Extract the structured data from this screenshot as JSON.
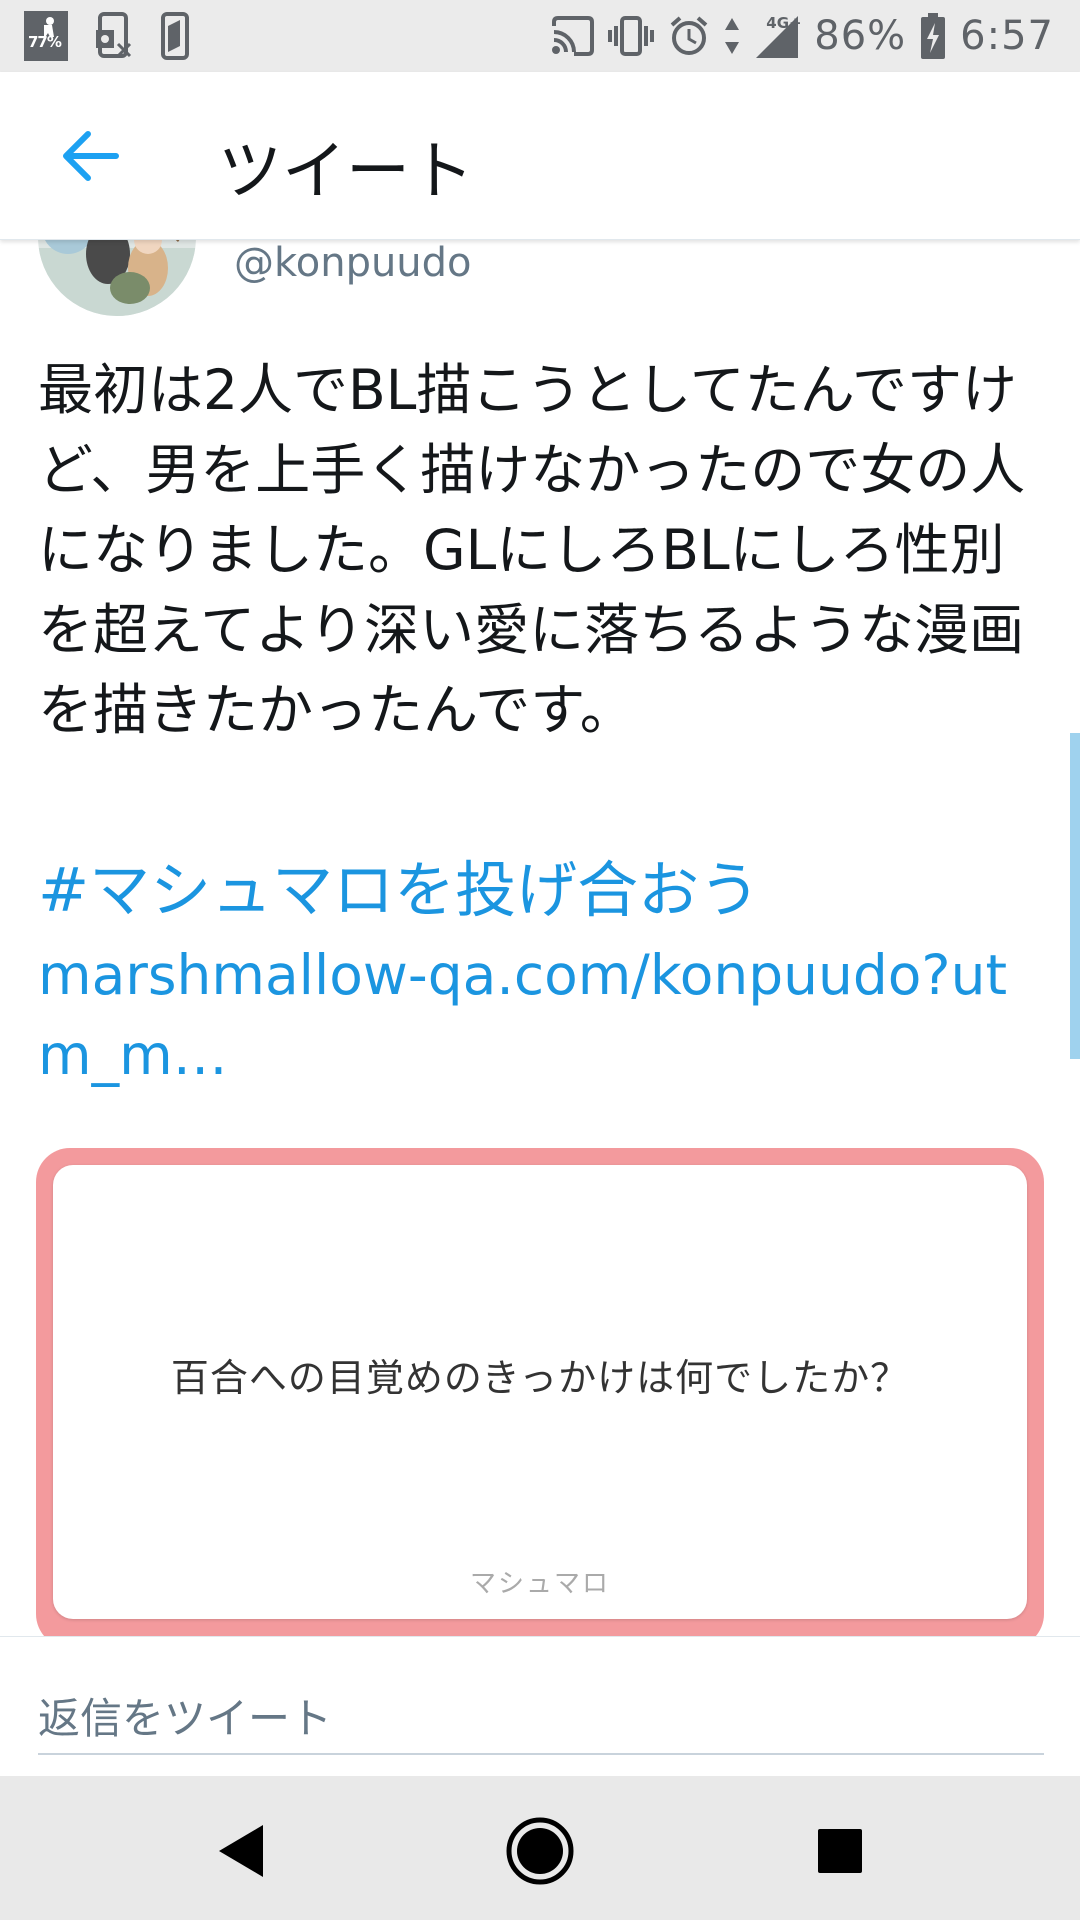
{
  "status_bar": {
    "battery_app_badge": "77%",
    "battery_percent": "86%",
    "network": "4G+",
    "time": "6:57",
    "icons": [
      "battery-widget-icon",
      "phone-mute-icon",
      "phone-icon",
      "cast-icon",
      "vibrate-icon",
      "alarm-icon",
      "data-arrows-icon",
      "signal-icon",
      "battery-charging-icon"
    ]
  },
  "app_bar": {
    "title": "ツイート",
    "back_icon": "arrow-left-icon",
    "accent_color": "#1da1f2"
  },
  "tweet": {
    "handle": "@konpuudo",
    "text": "最初は2人でBL描こうとしてたんですけど、男を上手く描けなかったので女の人になりました。GLにしろBLにしろ性別を超えてより深い愛に落ちるような漫画を描きたかったんです。",
    "hashtag": "#マシュマロを投げ合おう",
    "link": "marshmallow-qa.com/konpuudo?utm_m…",
    "link_color": "#1b95e0"
  },
  "card": {
    "question": "百合への目覚めのきっかけは何でしたか？",
    "brand": "マシュマロ",
    "border_color": "#f39a9d"
  },
  "reply": {
    "placeholder": "返信をツイート"
  },
  "nav_bar": {
    "back_icon": "nav-back-icon",
    "home_icon": "nav-home-icon",
    "recents_icon": "nav-recents-icon"
  }
}
